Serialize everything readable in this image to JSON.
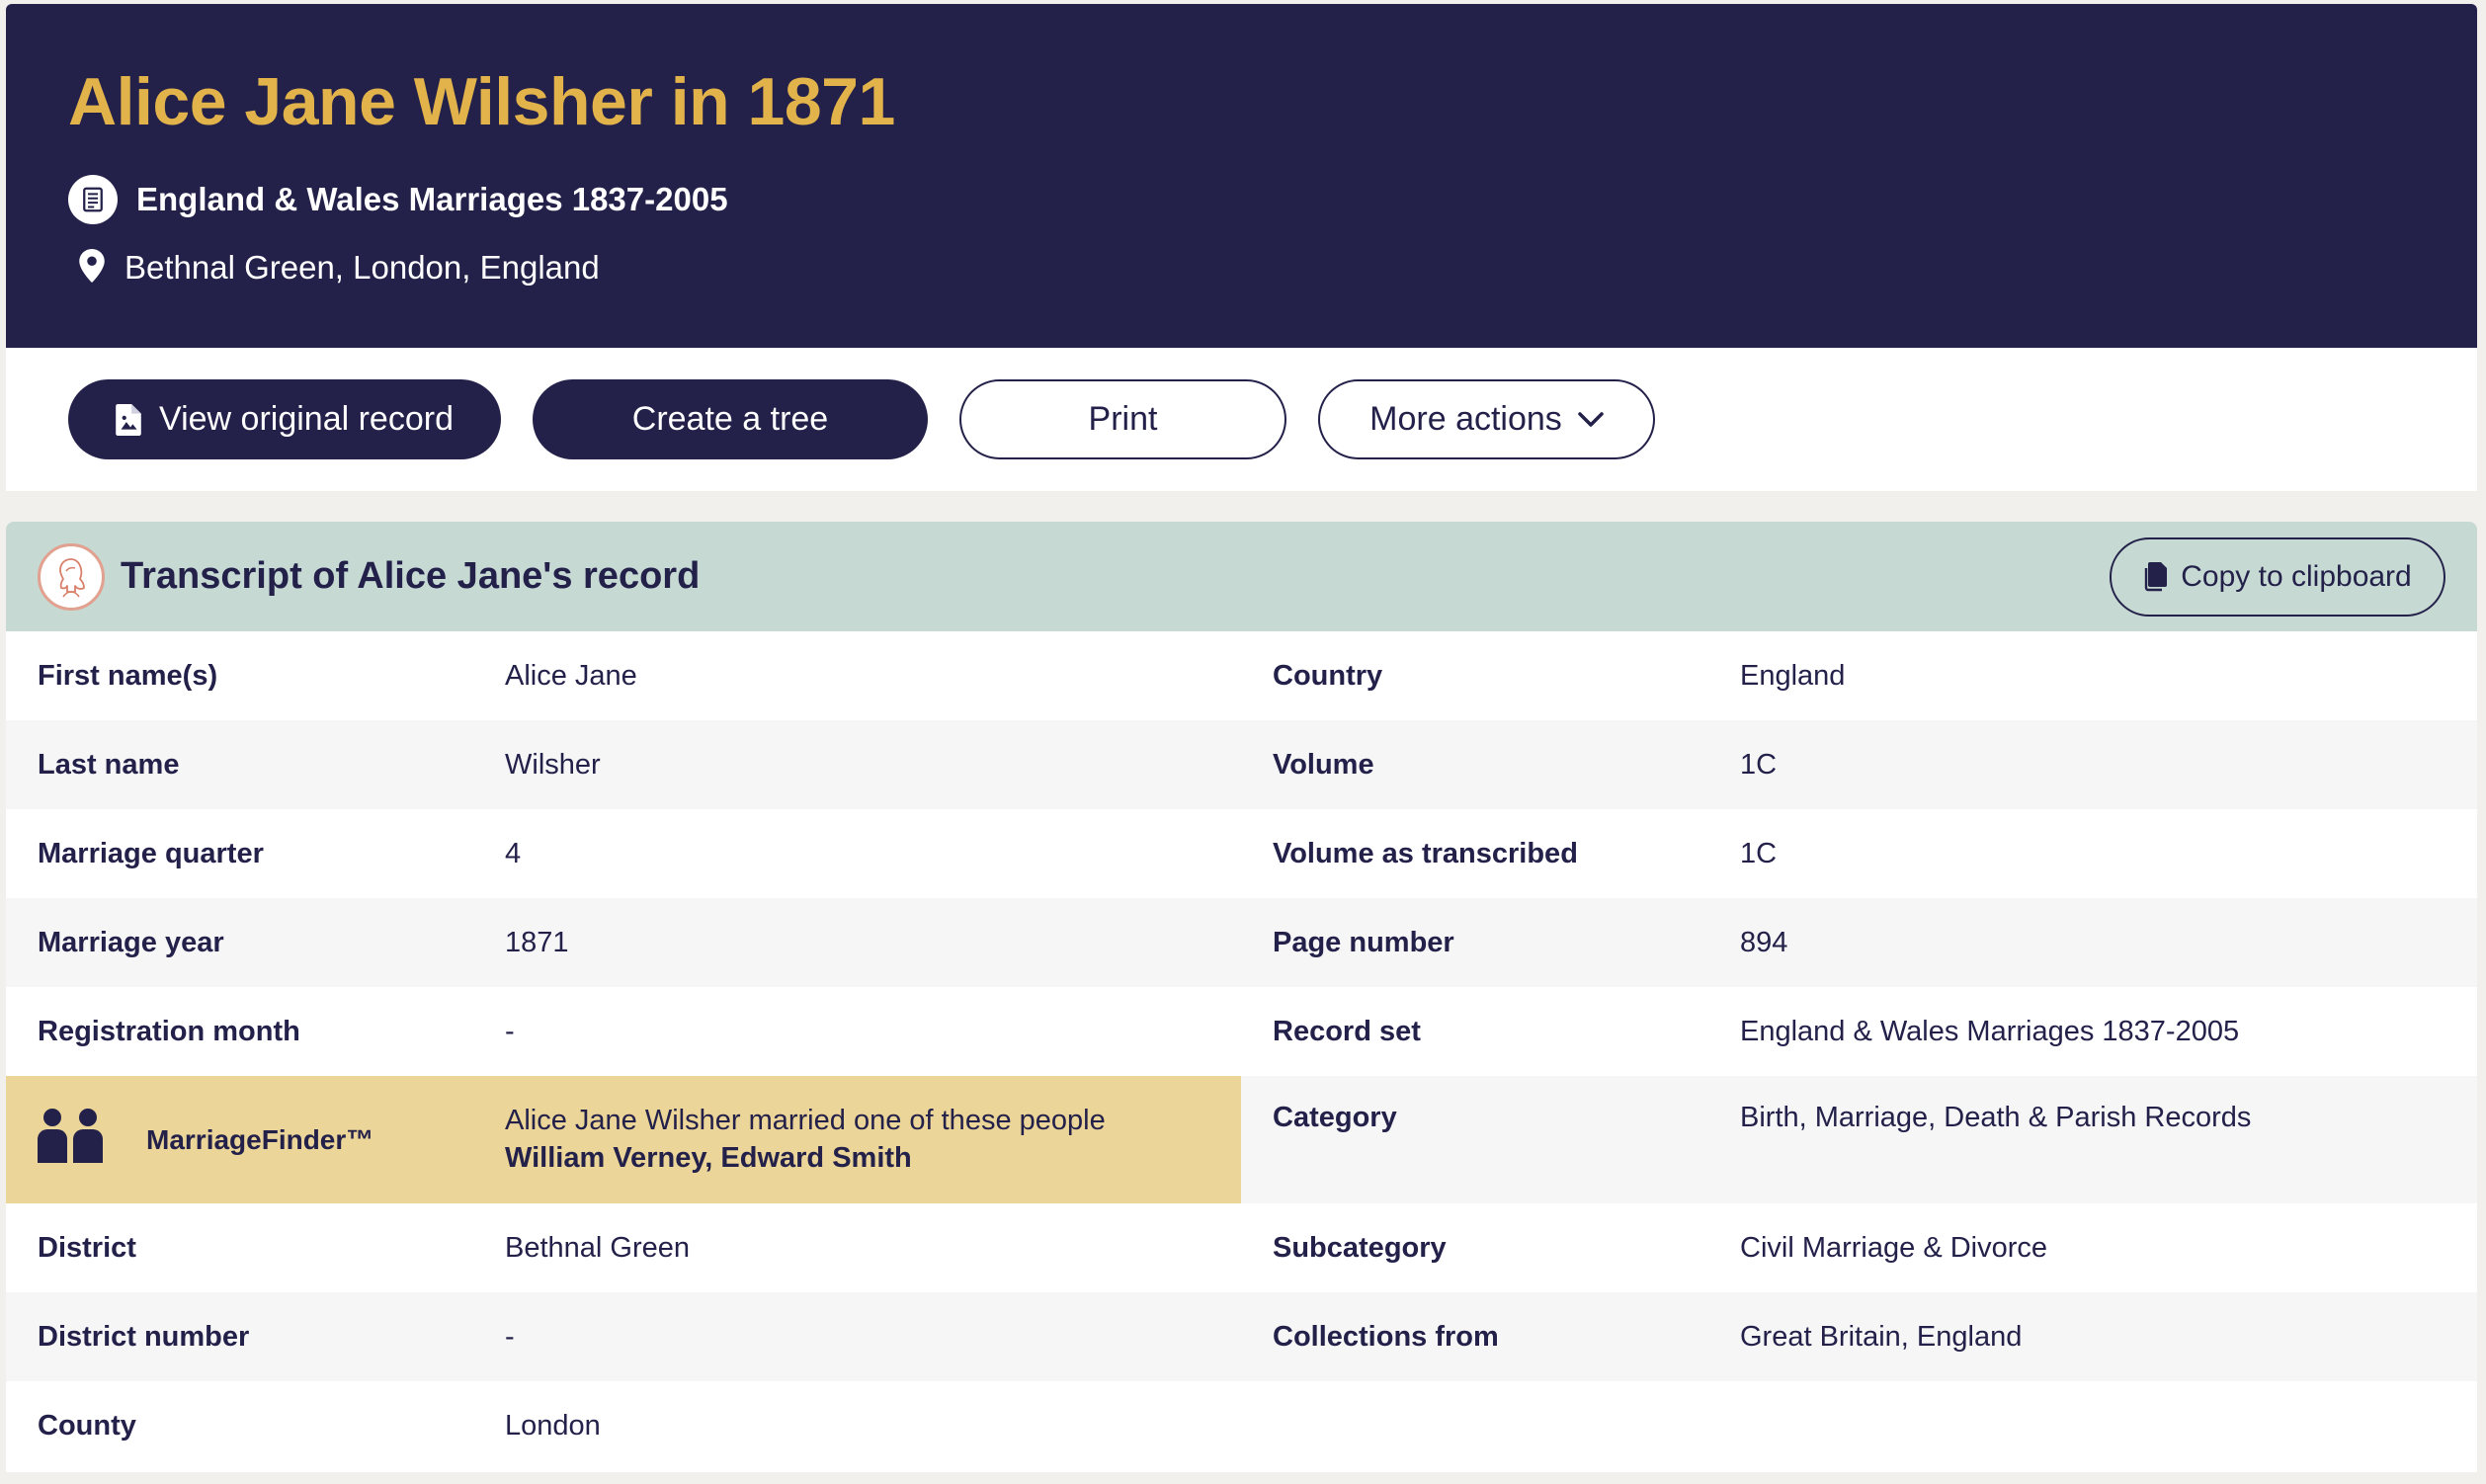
{
  "header": {
    "title": "Alice Jane Wilsher in 1871",
    "record_set": "England & Wales Marriages 1837-2005",
    "location": "Bethnal Green, London, England",
    "background": "#232149",
    "title_color": "#e2b34b"
  },
  "actions": {
    "view_original": "View original record",
    "create_tree": "Create a tree",
    "print": "Print",
    "more_actions": "More actions"
  },
  "transcript": {
    "title": "Transcript of Alice Jane's record",
    "copy_label": "Copy to clipboard",
    "header_color": "#c6d9d3",
    "rows": [
      {
        "l_label": "First name(s)",
        "l_value": "Alice Jane",
        "r_label": "Country",
        "r_value": "England"
      },
      {
        "l_label": "Last name",
        "l_value": "Wilsher",
        "r_label": "Volume",
        "r_value": "1C"
      },
      {
        "l_label": "Marriage quarter",
        "l_value": "4",
        "r_label": "Volume as transcribed",
        "r_value": "1C"
      },
      {
        "l_label": "Marriage year",
        "l_value": "1871",
        "r_label": "Page number",
        "r_value": "894"
      },
      {
        "l_label": "Registration month",
        "l_value": "-",
        "r_label": "Record set",
        "r_value": "England & Wales Marriages 1837-2005"
      },
      {
        "r_label": "Category",
        "r_value": "Birth, Marriage, Death & Parish Records"
      },
      {
        "l_label": "District",
        "l_value": "Bethnal Green",
        "r_label": "Subcategory",
        "r_value": "Civil Marriage & Divorce"
      },
      {
        "l_label": "District number",
        "l_value": "-",
        "r_label": "Collections from",
        "r_value": "Great Britain, England"
      },
      {
        "l_label": "County",
        "l_value": "London",
        "r_label": "",
        "r_value": ""
      }
    ],
    "marriage_finder": {
      "name": "MarriageFinder™",
      "text": "Alice Jane Wilsher married one of these people",
      "people": "William Verney, Edward Smith",
      "color": "#ebd598"
    }
  }
}
